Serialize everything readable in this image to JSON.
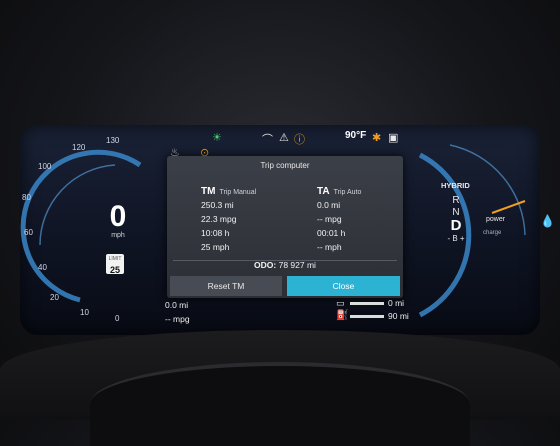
{
  "speedometer": {
    "speed": "0",
    "unit": "mph",
    "ticks": [
      "0",
      "10",
      "20",
      "40",
      "60",
      "80",
      "100",
      "120",
      "130"
    ],
    "speed_limit_label": "LIMIT",
    "speed_limit_value": "25"
  },
  "top_bar": {
    "temperature": "90°F",
    "icons": [
      "coolant-icon",
      "tire-pressure-icon",
      "headlight-icon",
      "windshield-washer-icon",
      "warning-triangle-icon",
      "info-icon",
      "lane-assist-icon",
      "car-doors-icon"
    ]
  },
  "popup": {
    "title": "Trip computer",
    "tm_code": "TM",
    "tm_label": "Trip Manual",
    "ta_code": "TA",
    "ta_label": "Trip Auto",
    "tm_rows": [
      "250.3 mi",
      "22.3 mpg",
      "10:08 h",
      "25 mph"
    ],
    "ta_rows": [
      "0.0 mi",
      "-- mpg",
      "00:01 h",
      "-- mph"
    ],
    "odo_label": "ODO:",
    "odo_value": "78 927 mi",
    "reset_button": "Reset TM",
    "close_button": "Close"
  },
  "bottom_left": {
    "distance": "0.0 mi",
    "economy": "-- mpg"
  },
  "bottom_right": {
    "battery_range": "0 mi",
    "fuel_range": "90 mi"
  },
  "drive_mode": {
    "mode": "HYBRID",
    "gears": [
      "R",
      "N",
      "D",
      "- B +"
    ],
    "selected_gear": "D",
    "power_label": "power",
    "charge_label": "charge"
  },
  "colors": {
    "accent": "#2cb3d4",
    "gauge_arc": "#3a86c8",
    "warning": "#f0a020",
    "green": "#3fd36a"
  }
}
